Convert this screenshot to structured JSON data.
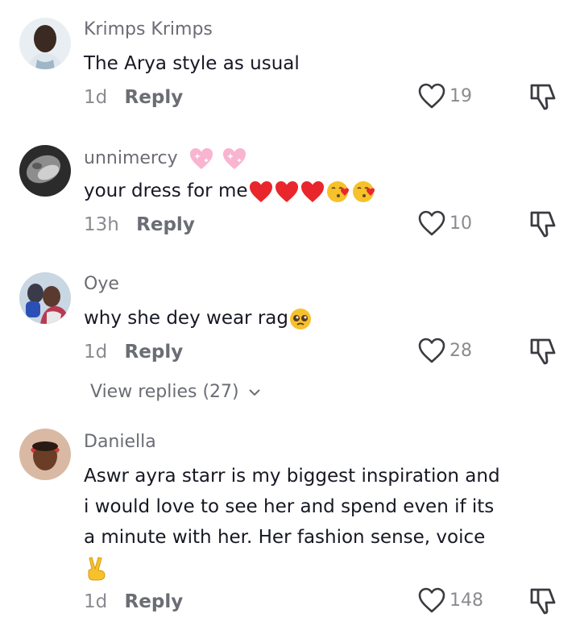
{
  "comments": [
    {
      "username": "Krimps Krimps",
      "text": "The Arya style as usual",
      "time": "1d",
      "reply_label": "Reply",
      "likes": "19"
    },
    {
      "username": "unnimercy",
      "text": "your dress for me",
      "time": "13h",
      "reply_label": "Reply",
      "likes": "10"
    },
    {
      "username": "Oye",
      "text": "why she dey wear rag",
      "time": "1d",
      "reply_label": "Reply",
      "likes": "28",
      "view_replies": "View replies (27)"
    },
    {
      "username": "Daniella",
      "text": "Aswr ayra starr is my biggest inspiration and\ni would love to see her and spend even if its\na minute with her. Her fashion sense, voice",
      "time": "1d",
      "reply_label": "Reply",
      "likes": "148"
    }
  ],
  "colors": {
    "heart_outline": "#3a3b40",
    "emoji_heart": "#e8262b",
    "username": "#6b6d74"
  },
  "icons": {
    "like": "heart-outline-icon",
    "dislike": "thumbs-down-icon",
    "chevron": "chevron-down-icon"
  }
}
